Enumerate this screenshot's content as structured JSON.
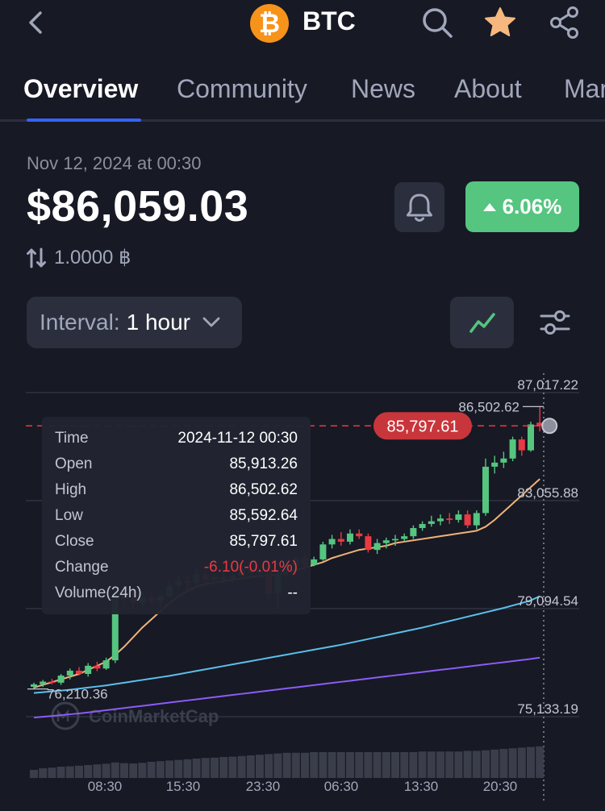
{
  "header": {
    "title": "BTC",
    "coin_symbol": "₿",
    "icons": [
      "back-chevron-icon",
      "search-icon",
      "star-icon",
      "share-icon"
    ],
    "star_color": "#F6B87E",
    "coin_color": "#F7931A"
  },
  "tabs": [
    {
      "label": "Overview",
      "active": true
    },
    {
      "label": "Community",
      "active": false
    },
    {
      "label": "News",
      "active": false
    },
    {
      "label": "About",
      "active": false
    },
    {
      "label": "Mar",
      "active": false
    }
  ],
  "price_block": {
    "timestamp": "Nov 12, 2024 at 00:30",
    "price": "$86,059.03",
    "change_pct": "6.06%",
    "change_color": "#55C580",
    "btc_amount": "1.0000 ฿"
  },
  "controls": {
    "interval_label": "Interval:",
    "interval_value": "1 hour",
    "chart_type_icon": "line-chart-icon",
    "settings_icon": "sliders-icon"
  },
  "chart_data": {
    "type": "candlestick",
    "y_ticks": [
      87017.22,
      83055.88,
      79094.54,
      75133.19
    ],
    "y_tick_labels": [
      "87,017.22",
      "83,055.88",
      "79,094.54",
      "75,133.19"
    ],
    "x_tick_labels": [
      "08:30",
      "15:30",
      "23:30",
      "06:30",
      "13:30",
      "20:30"
    ],
    "current_price_label": "85,797.61",
    "current_price": 85797.61,
    "high_marker_label": "86,502.62",
    "low_marker_label": "76,210.36",
    "watermark": "CoinMarketCap",
    "colors": {
      "up": "#55C580",
      "down": "#EA3943",
      "ma_short": "#F0B27A",
      "ma_mid": "#5BC0EB",
      "ma_long": "#8B5CF6"
    },
    "candles": [
      {
        "o": 76230,
        "h": 76380,
        "l": 76150,
        "c": 76320
      },
      {
        "o": 76320,
        "h": 76480,
        "l": 76220,
        "c": 76420
      },
      {
        "o": 76420,
        "h": 76520,
        "l": 76320,
        "c": 76380
      },
      {
        "o": 76380,
        "h": 76700,
        "l": 76300,
        "c": 76640
      },
      {
        "o": 76640,
        "h": 76900,
        "l": 76500,
        "c": 76820
      },
      {
        "o": 76820,
        "h": 76950,
        "l": 76650,
        "c": 76700
      },
      {
        "o": 76700,
        "h": 77100,
        "l": 76600,
        "c": 77000
      },
      {
        "o": 77000,
        "h": 77150,
        "l": 76800,
        "c": 76900
      },
      {
        "o": 76900,
        "h": 77300,
        "l": 76850,
        "c": 77200
      },
      {
        "o": 77200,
        "h": 79900,
        "l": 77100,
        "c": 79600
      },
      {
        "o": 79600,
        "h": 79950,
        "l": 79200,
        "c": 79450
      },
      {
        "o": 79450,
        "h": 79700,
        "l": 79100,
        "c": 79300
      },
      {
        "o": 79300,
        "h": 79700,
        "l": 79150,
        "c": 79500
      },
      {
        "o": 79500,
        "h": 79650,
        "l": 79250,
        "c": 79400
      },
      {
        "o": 79400,
        "h": 79600,
        "l": 79150,
        "c": 79550
      },
      {
        "o": 79550,
        "h": 80100,
        "l": 79500,
        "c": 79950
      },
      {
        "o": 79950,
        "h": 80300,
        "l": 79800,
        "c": 80100
      },
      {
        "o": 80100,
        "h": 80250,
        "l": 79800,
        "c": 80050
      },
      {
        "o": 80050,
        "h": 80600,
        "l": 79900,
        "c": 80350
      },
      {
        "o": 80350,
        "h": 80500,
        "l": 79900,
        "c": 80150
      },
      {
        "o": 80150,
        "h": 80350,
        "l": 79950,
        "c": 80250
      },
      {
        "o": 80250,
        "h": 80400,
        "l": 80000,
        "c": 80150
      },
      {
        "o": 80150,
        "h": 80500,
        "l": 80050,
        "c": 80300
      },
      {
        "o": 80300,
        "h": 80700,
        "l": 80200,
        "c": 80550
      },
      {
        "o": 80550,
        "h": 80700,
        "l": 80300,
        "c": 80400
      },
      {
        "o": 80400,
        "h": 80600,
        "l": 80250,
        "c": 80500
      },
      {
        "o": 80500,
        "h": 80650,
        "l": 79450,
        "c": 79650
      },
      {
        "o": 79650,
        "h": 80500,
        "l": 79100,
        "c": 80400
      },
      {
        "o": 80400,
        "h": 80900,
        "l": 80250,
        "c": 80700
      },
      {
        "o": 80700,
        "h": 81000,
        "l": 80600,
        "c": 80950
      },
      {
        "o": 80950,
        "h": 81100,
        "l": 80500,
        "c": 80700
      },
      {
        "o": 80700,
        "h": 81000,
        "l": 80650,
        "c": 80900
      },
      {
        "o": 80900,
        "h": 81550,
        "l": 80850,
        "c": 81450
      },
      {
        "o": 81450,
        "h": 81800,
        "l": 81300,
        "c": 81650
      },
      {
        "o": 81650,
        "h": 81900,
        "l": 81400,
        "c": 81550
      },
      {
        "o": 81550,
        "h": 82000,
        "l": 81450,
        "c": 81850
      },
      {
        "o": 81850,
        "h": 82000,
        "l": 81650,
        "c": 81750
      },
      {
        "o": 81750,
        "h": 81850,
        "l": 81150,
        "c": 81250
      },
      {
        "o": 81250,
        "h": 81650,
        "l": 81100,
        "c": 81500
      },
      {
        "o": 81500,
        "h": 81700,
        "l": 81300,
        "c": 81600
      },
      {
        "o": 81600,
        "h": 81800,
        "l": 81400,
        "c": 81650
      },
      {
        "o": 81650,
        "h": 81850,
        "l": 81550,
        "c": 81750
      },
      {
        "o": 81750,
        "h": 82150,
        "l": 81650,
        "c": 82050
      },
      {
        "o": 82050,
        "h": 82300,
        "l": 81950,
        "c": 82200
      },
      {
        "o": 82200,
        "h": 82500,
        "l": 82100,
        "c": 82300
      },
      {
        "o": 82300,
        "h": 82550,
        "l": 82150,
        "c": 82400
      },
      {
        "o": 82400,
        "h": 82600,
        "l": 82200,
        "c": 82350
      },
      {
        "o": 82350,
        "h": 82700,
        "l": 82250,
        "c": 82550
      },
      {
        "o": 82550,
        "h": 82700,
        "l": 82050,
        "c": 82150
      },
      {
        "o": 82150,
        "h": 82700,
        "l": 82000,
        "c": 82600
      },
      {
        "o": 82600,
        "h": 84600,
        "l": 82500,
        "c": 84300
      },
      {
        "o": 84300,
        "h": 84700,
        "l": 84050,
        "c": 84450
      },
      {
        "o": 84450,
        "h": 84850,
        "l": 84250,
        "c": 84600
      },
      {
        "o": 84600,
        "h": 85400,
        "l": 84500,
        "c": 85300
      },
      {
        "o": 85300,
        "h": 85400,
        "l": 84700,
        "c": 84900
      },
      {
        "o": 84900,
        "h": 85950,
        "l": 84850,
        "c": 85850
      },
      {
        "o": 85913.26,
        "h": 86502.62,
        "l": 85592.64,
        "c": 85797.61
      }
    ],
    "ma_short": [
      76200,
      76300,
      76400,
      76500,
      76600,
      76700,
      76850,
      77000,
      77150,
      77400,
      77700,
      78050,
      78400,
      78700,
      79000,
      79300,
      79550,
      79750,
      79900,
      80000,
      80050,
      80100,
      80150,
      80200,
      80250,
      80300,
      80300,
      80350,
      80400,
      80500,
      80600,
      80700,
      80800,
      80950,
      81050,
      81150,
      81250,
      81300,
      81350,
      81400,
      81500,
      81550,
      81600,
      81650,
      81700,
      81750,
      81800,
      81850,
      81900,
      81950,
      82100,
      82350,
      82650,
      82950,
      83250,
      83550,
      83850
    ],
    "ma_mid": [
      76000,
      76030,
      76060,
      76090,
      76120,
      76160,
      76200,
      76240,
      76280,
      76330,
      76380,
      76430,
      76480,
      76530,
      76580,
      76630,
      76690,
      76750,
      76810,
      76870,
      76930,
      76990,
      77050,
      77110,
      77170,
      77230,
      77290,
      77350,
      77410,
      77470,
      77530,
      77590,
      77650,
      77710,
      77770,
      77840,
      77910,
      77980,
      78050,
      78120,
      78190,
      78260,
      78330,
      78400,
      78480,
      78560,
      78640,
      78720,
      78800,
      78880,
      78960,
      79040,
      79120,
      79210,
      79300,
      79400,
      79550
    ],
    "ma_long": [
      75100,
      75130,
      75160,
      75190,
      75220,
      75250,
      75290,
      75330,
      75370,
      75410,
      75450,
      75490,
      75530,
      75570,
      75610,
      75650,
      75690,
      75730,
      75770,
      75810,
      75850,
      75890,
      75930,
      75970,
      76010,
      76050,
      76090,
      76130,
      76170,
      76210,
      76250,
      76290,
      76330,
      76370,
      76410,
      76450,
      76490,
      76530,
      76570,
      76610,
      76650,
      76690,
      76730,
      76770,
      76810,
      76850,
      76890,
      76930,
      76970,
      77010,
      77050,
      77090,
      77130,
      77170,
      77210,
      77250,
      77300
    ],
    "volumes": [
      0.25,
      0.3,
      0.32,
      0.35,
      0.36,
      0.38,
      0.4,
      0.42,
      0.44,
      0.48,
      0.46,
      0.45,
      0.47,
      0.5,
      0.52,
      0.54,
      0.56,
      0.58,
      0.6,
      0.62,
      0.63,
      0.65,
      0.66,
      0.68,
      0.7,
      0.72,
      0.74,
      0.76,
      0.78,
      0.78,
      0.78,
      0.8,
      0.8,
      0.8,
      0.8,
      0.8,
      0.8,
      0.8,
      0.8,
      0.8,
      0.8,
      0.8,
      0.8,
      0.82,
      0.82,
      0.82,
      0.82,
      0.82,
      0.84,
      0.84,
      0.86,
      0.88,
      0.9,
      0.92,
      0.94,
      0.96,
      0.98
    ]
  },
  "tooltip": {
    "rows": [
      {
        "key": "Time",
        "value": "2024-11-12 00:30"
      },
      {
        "key": "Open",
        "value": "85,913.26"
      },
      {
        "key": "High",
        "value": "86,502.62"
      },
      {
        "key": "Low",
        "value": "85,592.64"
      },
      {
        "key": "Close",
        "value": "85,797.61"
      },
      {
        "key": "Change",
        "value": "-6.10(-0.01%)"
      },
      {
        "key": "Volume(24h)",
        "value": "--"
      }
    ]
  }
}
